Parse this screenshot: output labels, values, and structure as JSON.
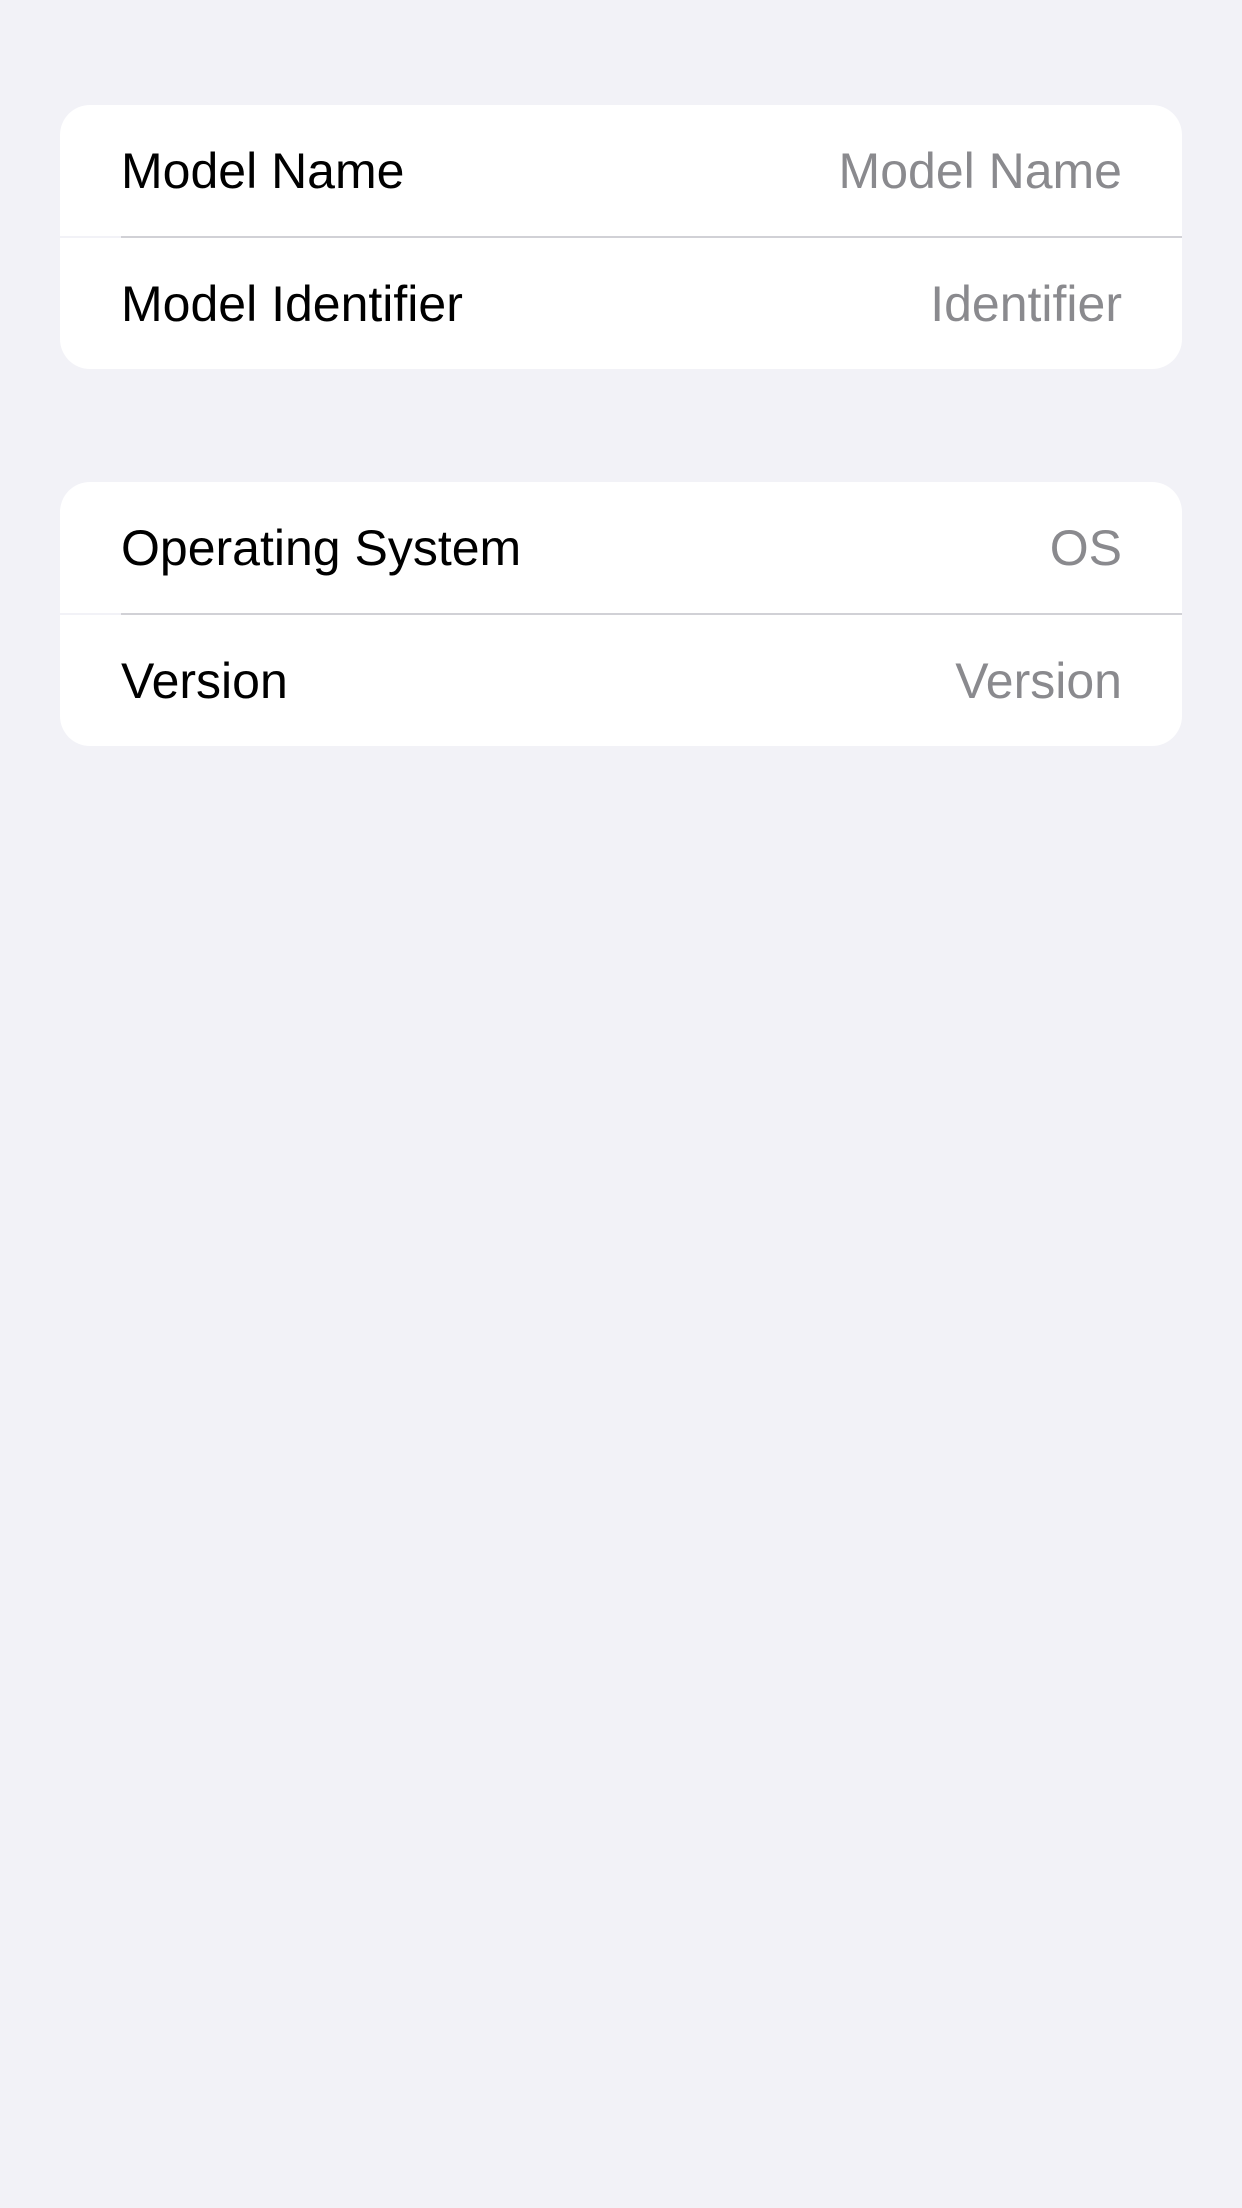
{
  "device_info": {
    "hardware": {
      "rows": [
        {
          "label": "Model Name",
          "value": "Model Name"
        },
        {
          "label": "Model Identifier",
          "value": "Identifier"
        }
      ]
    },
    "software": {
      "rows": [
        {
          "label": "Operating System",
          "value": "OS"
        },
        {
          "label": "Version",
          "value": "Version"
        }
      ]
    }
  },
  "colors": {
    "background": "#F2F2F7",
    "card": "#FFFFFF",
    "label": "#000000",
    "secondary_value": "#8A8A8E",
    "separator": "#D1D1D6"
  }
}
